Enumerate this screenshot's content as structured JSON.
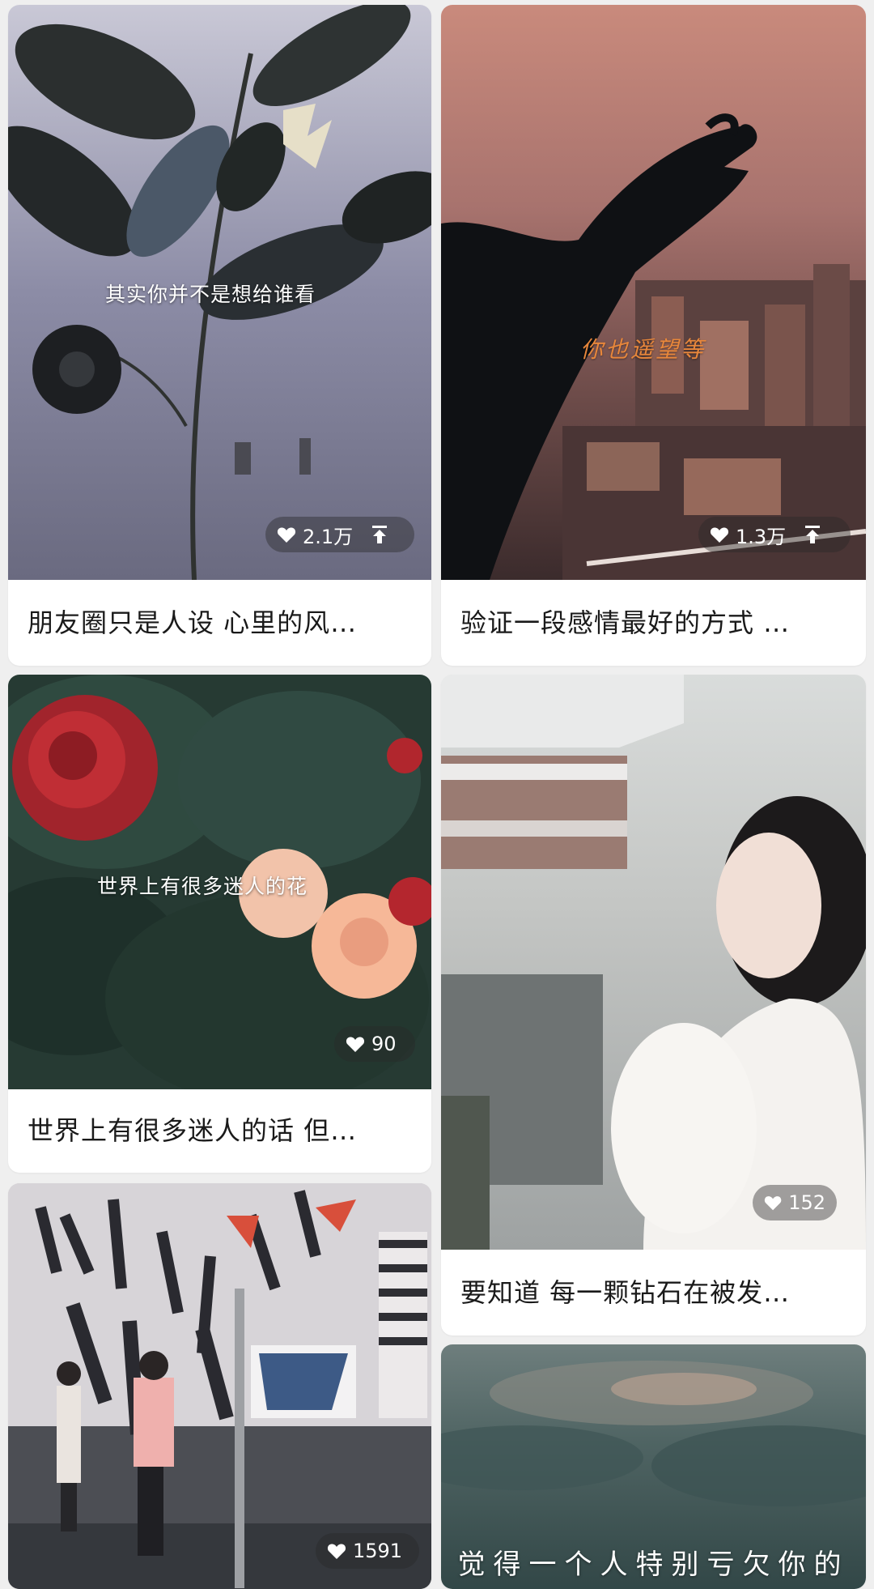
{
  "cards": [
    {
      "overlay": "其实你并不是想给谁看",
      "likes": "2.1万",
      "caption": "朋友圈只是人设 心里的风…"
    },
    {
      "overlay": "你也遥望等",
      "likes": "1.3万",
      "caption": "验证一段感情最好的方式 …"
    },
    {
      "overlay": "世界上有很多迷人的花",
      "likes": "90",
      "caption": "世界上有很多迷人的话 但…"
    },
    {
      "overlay": "",
      "likes": "152",
      "caption": "要知道 每一颗钻石在被发…"
    },
    {
      "overlay": "",
      "likes": "1591",
      "caption": ""
    },
    {
      "overlay": "觉得一个人特别亏欠你的",
      "likes": "",
      "caption": ""
    }
  ],
  "icons": {
    "like": "heart-icon",
    "pinned": "pin-top-icon"
  },
  "colors": {
    "background": "#efefef",
    "card": "#ffffff",
    "caption_text": "#1a1a1a"
  }
}
